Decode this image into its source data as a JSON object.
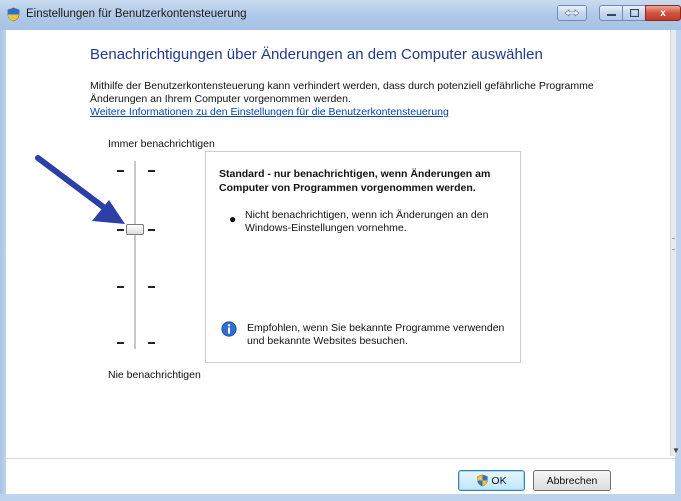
{
  "window": {
    "title": "Einstellungen für Benutzerkontensteuerung",
    "close_glyph": "x",
    "title_icon": "uac-shield-icon"
  },
  "main": {
    "heading": "Benachrichtigungen über Änderungen an dem Computer auswählen",
    "description": "Mithilfe der Benutzerkontensteuerung kann verhindert werden, dass durch potenziell gefährliche Programme Änderungen an Ihrem Computer vorgenommen werden.",
    "link": "Weitere Informationen zu den Einstellungen für die Benutzerkontensteuerung"
  },
  "slider": {
    "top_label": "Immer benachrichtigen",
    "bottom_label": "Nie benachrichtigen",
    "levels": 4,
    "selected_level": 2
  },
  "panel": {
    "title": "Standard - nur benachrichtigen, wenn Änderungen am Computer von Programmen vorgenommen werden.",
    "bullet": "Nicht benachrichtigen, wenn ich Änderungen an den Windows-Einstellungen vornehme.",
    "recommendation": "Empfohlen, wenn Sie bekannte Programme verwenden und bekannte Websites besuchen."
  },
  "buttons": {
    "ok": "OK",
    "cancel": "Abbrechen"
  },
  "colors": {
    "heading": "#1e3a8a",
    "link": "#0645ad",
    "arrow": "#2b3fa6"
  }
}
